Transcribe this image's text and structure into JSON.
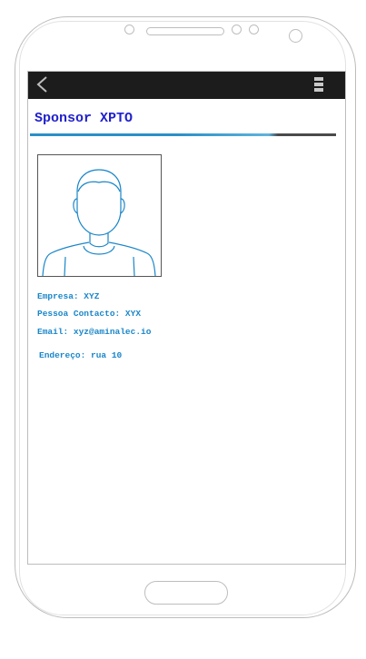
{
  "screen": {
    "title": "Sponsor XPTO",
    "accent_color": "#2222cc",
    "link_color": "#1a86c9",
    "appbar": {
      "back_icon": "chevron-left-icon",
      "menu_icon": "overflow-menu-icon"
    }
  },
  "sponsor": {
    "photo_icon": "user-avatar-icon",
    "company": "Empresa: XYZ",
    "contact": "Pessoa Contacto: XYX",
    "email": "Email: xyz@aminalec.io",
    "address": "Endereço: rua 10"
  }
}
